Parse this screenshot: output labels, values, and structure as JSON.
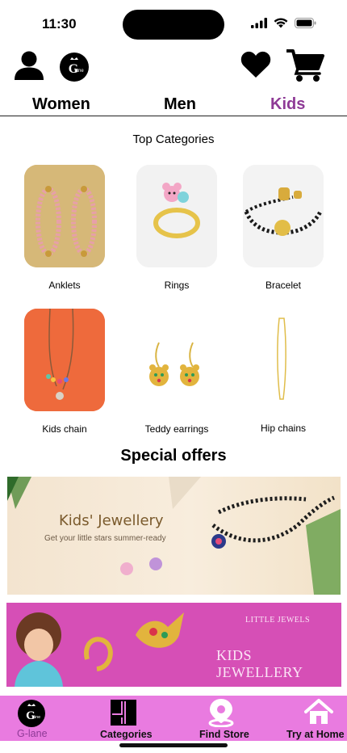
{
  "status_bar": {
    "time": "11:30"
  },
  "header": {
    "profile_icon": "person-icon",
    "logo_text": "G-lane",
    "wishlist_icon": "heart-icon",
    "cart_icon": "cart-icon"
  },
  "tabs": [
    {
      "label": "Women",
      "active": false
    },
    {
      "label": "Men",
      "active": false
    },
    {
      "label": "Kids",
      "active": true
    }
  ],
  "accent_color": "#8e3a96",
  "top_categories": {
    "title": "Top Categories",
    "items": [
      {
        "label": "Anklets"
      },
      {
        "label": "Rings"
      },
      {
        "label": "Bracelet"
      },
      {
        "label": "Kids chain"
      },
      {
        "label": "Teddy earrings"
      },
      {
        "label": "Hip chains"
      }
    ]
  },
  "special_offers": {
    "title": "Special offers",
    "banners": [
      {
        "title": "Kids' Jewellery",
        "subtitle": "Get your little stars summer-ready"
      },
      {
        "line1": "LITTLE JEWELS",
        "line2": "KIDS JEWELLERY"
      }
    ]
  },
  "bottom_nav": {
    "background": "#e97be0",
    "items": [
      {
        "label": "G-lane",
        "icon": "glane-logo-icon",
        "label_color": "#8e3a96"
      },
      {
        "label": "Categories",
        "icon": "categories-icon"
      },
      {
        "label": "Find Store",
        "icon": "location-pin-icon"
      },
      {
        "label": "Try at Home",
        "icon": "home-icon"
      }
    ]
  }
}
